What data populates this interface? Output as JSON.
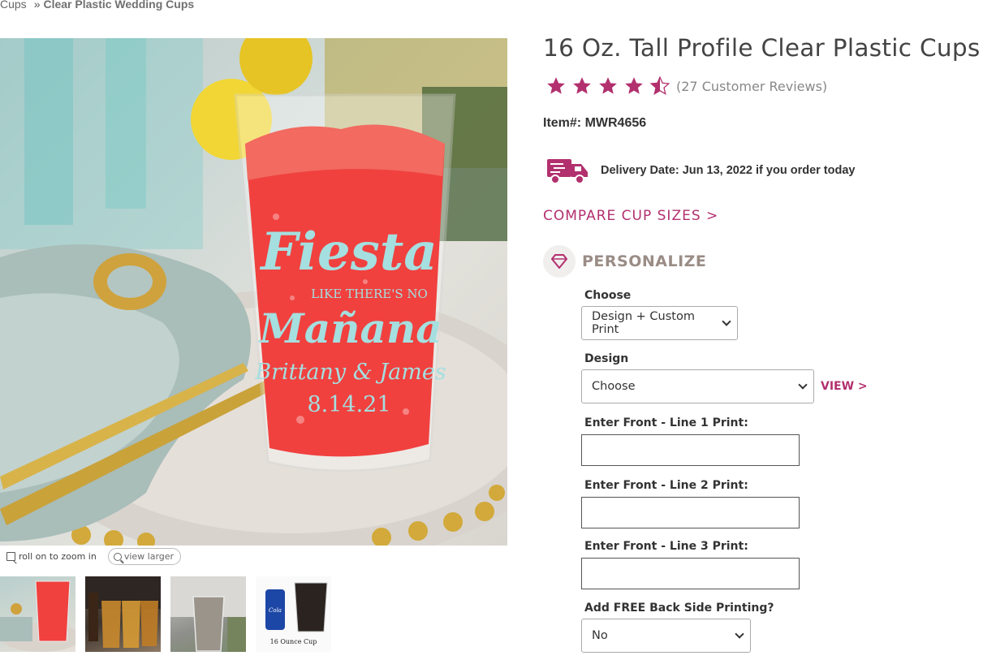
{
  "breadcrumb": {
    "parent": "Cups",
    "separator": "»",
    "current": "Clear Plastic Wedding Cups"
  },
  "product": {
    "title": "16 Oz. Tall Profile Clear Plastic Cups",
    "rating": 4.5,
    "rating_max": 5,
    "reviews_text": "(27 Customer Reviews)",
    "item_number": "Item#: MWR4656",
    "delivery_text": "Delivery Date: Jun 13, 2022 if you order today",
    "compare_link": "COMPARE CUP SIZES >"
  },
  "gallery": {
    "zoom_hint": "roll on to zoom in",
    "view_larger": "view larger",
    "cup_print": {
      "line1": "Fiesta",
      "line2": "LIKE THERE'S NO",
      "line3": "Mañana",
      "line4": "Brittany & James",
      "line5": "8.14.21"
    },
    "thumb4_caption": "16 Ounce Cup",
    "thumb4_can_label": "Cola"
  },
  "personalize": {
    "heading": "PERSONALIZE",
    "choose_label": "Choose",
    "choose_value": "Design + Custom Print",
    "design_label": "Design",
    "design_value": "Choose",
    "view_link": "VIEW >",
    "line1_label": "Enter Front - Line 1 Print:",
    "line1_value": "",
    "line2_label": "Enter Front - Line 2 Print:",
    "line2_value": "",
    "line3_label": "Enter Front - Line 3 Print:",
    "line3_value": "",
    "back_label": "Add FREE Back Side Printing?",
    "back_value": "No"
  },
  "colors": {
    "accent": "#b2306e",
    "star": "#b2306e",
    "text": "#333333"
  }
}
